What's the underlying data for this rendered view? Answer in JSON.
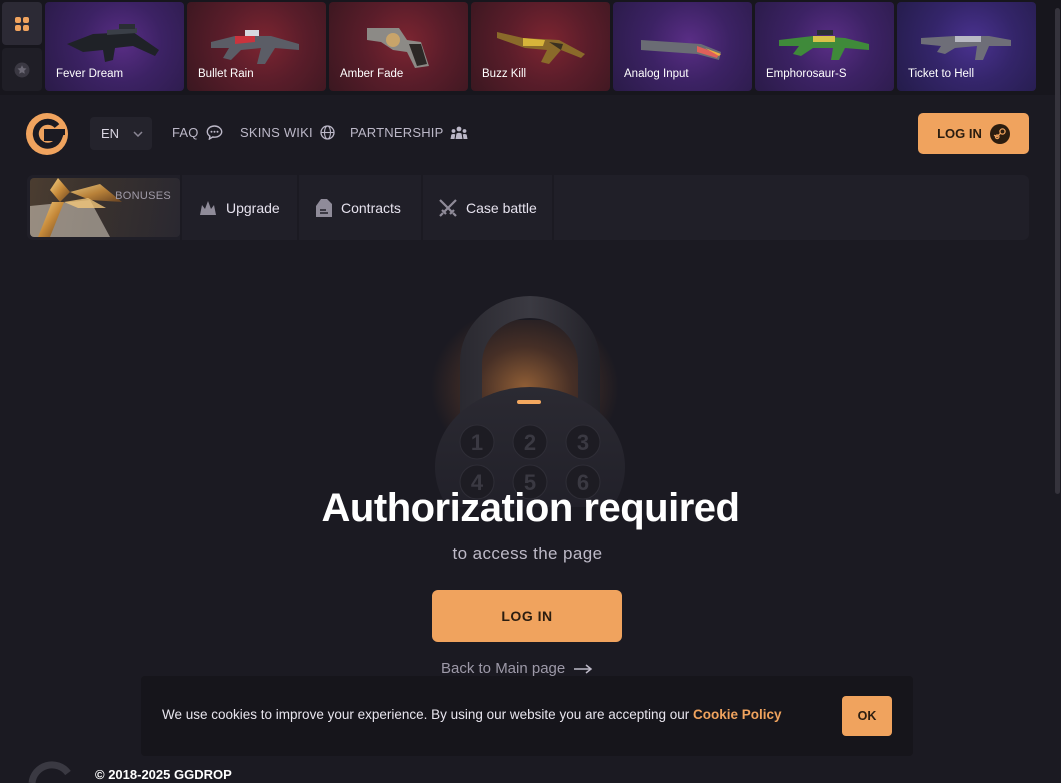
{
  "strip": {
    "items": [
      {
        "name": "Fever Dream",
        "rarity": "purple"
      },
      {
        "name": "Bullet Rain",
        "rarity": "red"
      },
      {
        "name": "Amber Fade",
        "rarity": "red"
      },
      {
        "name": "Buzz Kill",
        "rarity": "red"
      },
      {
        "name": "Analog Input",
        "rarity": "purple"
      },
      {
        "name": "Emphorosaur-S",
        "rarity": "purple"
      },
      {
        "name": "Ticket to Hell",
        "rarity": "blue"
      }
    ]
  },
  "header": {
    "lang": "EN",
    "nav": {
      "faq": "FAQ",
      "skins_wiki": "SKINS WIKI",
      "partnership": "PARTNERSHIP"
    },
    "login_label": "LOG IN"
  },
  "gamemenu": {
    "bonuses_label": "BONUSES",
    "upgrade": "Upgrade",
    "contracts": "Contracts",
    "case_battle": "Case battle"
  },
  "auth": {
    "title": "Authorization required",
    "subtitle": "to access the page",
    "login_label": "LOG IN",
    "back_label": "Back to Main page"
  },
  "cookie": {
    "text": "We use cookies to improve your experience. By using our website you are accepting our ",
    "policy_label": "Cookie Policy",
    "ok_label": "OK"
  },
  "footer": {
    "copyright": "© 2018-2025 GGDROP"
  },
  "colors": {
    "accent": "#f0a35e",
    "background": "#1b1a22",
    "panel": "#201f28"
  }
}
